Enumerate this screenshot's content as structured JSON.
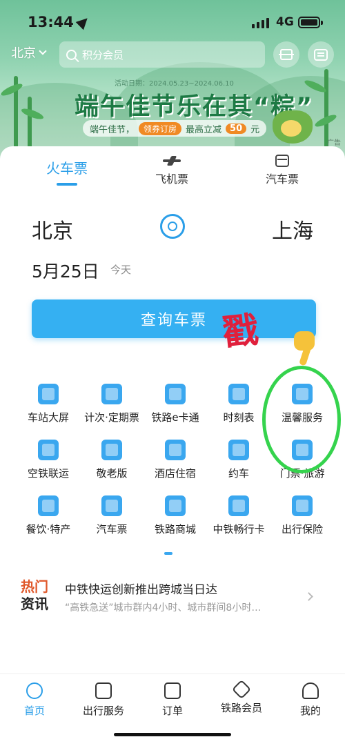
{
  "status_bar": {
    "time": "13:44",
    "network": "4G"
  },
  "top_bar": {
    "city": "北京",
    "search_placeholder": "积分会员"
  },
  "banner": {
    "date_text": "活动日期：2024.05.23~2024.06.10",
    "title": "端午佳节乐在其“粽”",
    "sub_prefix": "端午佳节，",
    "sub_pill": "领券订房",
    "sub_mid": "最高立减",
    "sub_amount": "50",
    "sub_suffix": "元",
    "ad_label": "广告"
  },
  "tabs": [
    {
      "label": "火车票",
      "active": true
    },
    {
      "label": "飞机票",
      "active": false
    },
    {
      "label": "汽车票",
      "active": false
    }
  ],
  "route": {
    "from": "北京",
    "to": "上海",
    "date": "5月25日",
    "date_note": "今天"
  },
  "query_button": "查询车票",
  "overlay": {
    "stamp_text": "戳"
  },
  "services": [
    {
      "label": "车站大屏",
      "icon": "calendar-grid-icon"
    },
    {
      "label": "计次·定期票",
      "icon": "ticket-clock-icon"
    },
    {
      "label": "铁路e卡通",
      "icon": "card-train-icon"
    },
    {
      "label": "时刻表",
      "icon": "train-front-icon"
    },
    {
      "label": "温馨服务",
      "icon": "heart-box-icon"
    },
    {
      "label": "空铁联运",
      "icon": "plane-train-icon"
    },
    {
      "label": "敬老版",
      "icon": "heart-icon"
    },
    {
      "label": "酒店住宿",
      "icon": "hotel-building-icon"
    },
    {
      "label": "约车",
      "icon": "car-icon"
    },
    {
      "label": "门票·旅游",
      "icon": "mountain-icon"
    },
    {
      "label": "餐饮·特产",
      "icon": "fork-knife-icon"
    },
    {
      "label": "汽车票",
      "icon": "bus-icon"
    },
    {
      "label": "铁路商城",
      "icon": "cart-icon"
    },
    {
      "label": "中铁畅行卡",
      "icon": "card-icon"
    },
    {
      "label": "出行保险",
      "icon": "shield-icon"
    }
  ],
  "hot_news": {
    "tag_line1": "热门",
    "tag_line2": "资讯",
    "title": "中铁快运创新推出跨城当日达",
    "desc": "“高铁急送”城市群内4小时、城市群间8小时…"
  },
  "bottom_nav": [
    {
      "label": "首页",
      "icon": "home-icon",
      "active": true
    },
    {
      "label": "出行服务",
      "icon": "luggage-icon",
      "active": false
    },
    {
      "label": "订单",
      "icon": "order-icon",
      "active": false
    },
    {
      "label": "铁路会员",
      "icon": "diamond-icon",
      "active": false
    },
    {
      "label": "我的",
      "icon": "user-icon",
      "active": false
    }
  ]
}
